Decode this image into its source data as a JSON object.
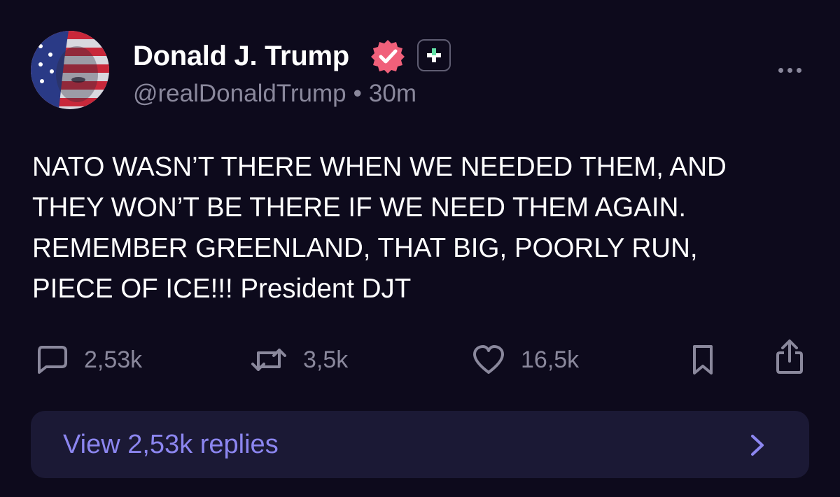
{
  "post": {
    "author_name": "Donald J. Trump",
    "handle": "@realDonaldTrump",
    "separator": "•",
    "time_ago": "30m",
    "text": "NATO WASN’T THERE WHEN WE NEEDED THEM, AND\nTHEY WON’T BE THERE IF WE NEED THEM AGAIN.\nREMEMBER GREENLAND, THAT BIG, POORLY RUN,\nPIECE OF ICE!!! President DJT"
  },
  "actions": {
    "replies_count": "2,53k",
    "reposts_count": "3,5k",
    "likes_count": "16,5k"
  },
  "replies_bar": {
    "label": "View 2,53k replies"
  },
  "icons": {
    "avatar": "flag-face-avatar",
    "verified": "verified-badge-icon",
    "plus": "plus-badge-icon",
    "more": "more-dots-icon",
    "reply": "comment-icon",
    "repost": "repost-icon",
    "like": "heart-icon",
    "bookmark": "bookmark-icon",
    "share": "share-icon",
    "chevron": "chevron-right-icon"
  },
  "colors": {
    "background": "#0d0a1c",
    "verified": "#f0607a",
    "plus_accent": "#63e0a6",
    "muted": "#8a889c",
    "link": "#8c86f0",
    "bar": "#1b1935"
  }
}
